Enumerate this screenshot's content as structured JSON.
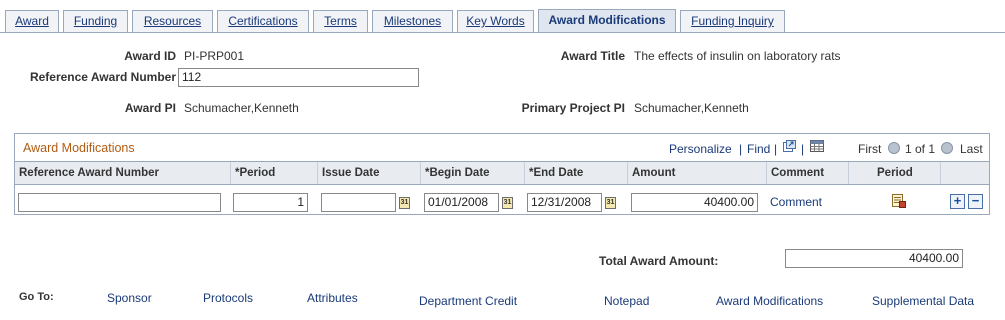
{
  "tabs": [
    {
      "label": "Award"
    },
    {
      "label": "Funding"
    },
    {
      "label": "Resources"
    },
    {
      "label": "Certifications"
    },
    {
      "label": "Terms"
    },
    {
      "label": "Milestones"
    },
    {
      "label": "Key Words"
    },
    {
      "label": "Award Modifications",
      "active": true
    },
    {
      "label": "Funding Inquiry"
    }
  ],
  "header": {
    "award_id_label": "Award ID",
    "award_id_value": "PI-PRP001",
    "award_title_label": "Award Title",
    "award_title_value": "The effects of insulin on laboratory rats",
    "ref_award_label": "Reference Award Number",
    "ref_award_value": "112",
    "award_pi_label": "Award PI",
    "award_pi_value": "Schumacher,Kenneth",
    "primary_pi_label": "Primary Project PI",
    "primary_pi_value": "Schumacher,Kenneth"
  },
  "grid": {
    "title": "Award Modifications",
    "personalize": "Personalize",
    "find": "Find",
    "separator": "|",
    "first": "First",
    "range": "1 of 1",
    "last": "Last",
    "columns": [
      "Reference Award Number",
      "*Period",
      "Issue Date",
      "*Begin Date",
      "*End Date",
      "Amount",
      "Comment",
      "Period"
    ],
    "row": {
      "ref_award_number": "",
      "period": "1",
      "issue_date": "",
      "begin_date": "01/01/2008",
      "end_date": "12/31/2008",
      "amount": "40400.00",
      "comment_link": "Comment"
    }
  },
  "total": {
    "label": "Total Award Amount:",
    "value": "40400.00"
  },
  "goto": {
    "label": "Go To:",
    "links": [
      "Sponsor",
      "Protocols",
      "Attributes",
      "Department Credit",
      "Notepad",
      "Award Modifications",
      "Supplemental Data"
    ]
  },
  "icons": {
    "calendar": "calendar-icon",
    "period_detail": "period-detail-icon",
    "add": "plus",
    "delete": "minus",
    "view_all": "view-all-icon",
    "download": "download-grid-icon"
  },
  "colors": {
    "grid_title": "#b25c14",
    "link": "#1a3a7a",
    "tab_border": "#9aa8bb"
  }
}
